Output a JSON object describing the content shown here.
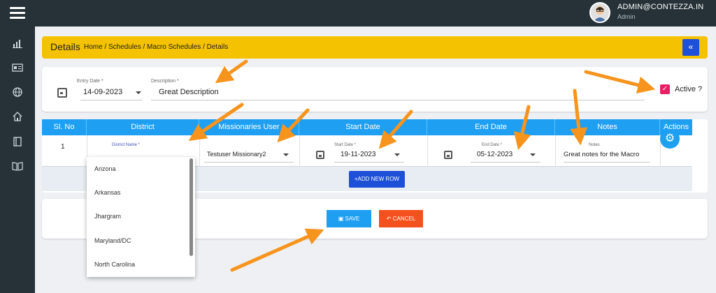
{
  "header": {
    "user_name": "ADMIN@CONTEZZA.IN",
    "user_role": "Admin"
  },
  "sidebar": {
    "items": [
      "chart-icon",
      "id-card-icon",
      "globe-icon",
      "home-icon",
      "book-icon",
      "open-book-icon"
    ]
  },
  "details": {
    "title": "Details",
    "breadcrumb": "Home / Schedules / Macro Schedules / Details",
    "collapse_label": "«"
  },
  "form": {
    "entry_date_label": "Entry Date *",
    "entry_date_value": "14-09-2023",
    "description_label": "Description *",
    "description_value": "Great Description",
    "active_label": "Active ?",
    "active_checked": true
  },
  "table": {
    "headers": [
      "Sl. No",
      "District",
      "Missionaries User",
      "Start Date",
      "End Date",
      "Notes",
      "Actions"
    ],
    "rows": [
      {
        "sl_no": "1",
        "district_label": "District Name *",
        "district_value": "",
        "missionary_value": "Testuser Missionary2",
        "start_date_label": "Start Date *",
        "start_date_value": "19-11-2023",
        "end_date_label": "End Date *",
        "end_date_value": "05-12-2023",
        "notes_label": "Notes",
        "notes_value": "Great notes for the Macro"
      }
    ],
    "add_row_label": "ADD NEW ROW"
  },
  "actions": {
    "save_label": "SAVE",
    "cancel_label": "CANCEL"
  },
  "district_dropdown": {
    "options": [
      "Arizona",
      "Arkansas",
      "Jhargram",
      "Maryland/DC",
      "North Carolina"
    ]
  },
  "colors": {
    "topbar": "#263238",
    "details_bar": "#f5c200",
    "table_header": "#1e9ff2",
    "primary": "#1e4fd8",
    "cancel": "#f4511e",
    "checkbox": "#e91e63",
    "arrow": "#f7941d"
  }
}
